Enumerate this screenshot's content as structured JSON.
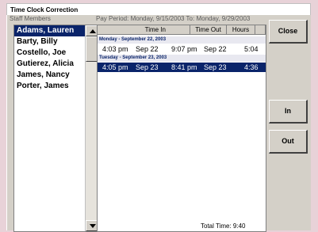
{
  "window": {
    "title": "Time Clock Correction"
  },
  "staff": {
    "label": "Staff Members",
    "items": [
      "Adams, Lauren",
      "Barty, Billy",
      "Costello, Joe",
      "Gutierez, Alicia",
      "James, Nancy",
      "Porter, James"
    ],
    "selected_index": 0
  },
  "pay_period": {
    "text": "Pay Period: Monday, 9/15/2003  To: Monday, 9/29/2003"
  },
  "grid": {
    "columns": [
      "Time In",
      "Time Out",
      "Hours"
    ],
    "days": [
      {
        "header": "Monday - September 22, 2003",
        "entries": [
          {
            "time_in": "4:03 pm",
            "date_in": "Sep 22",
            "time_out": "9:07 pm",
            "date_out": "Sep 22",
            "hours": "5:04"
          }
        ]
      },
      {
        "header": "Tuesday - September 23, 2003",
        "entries": [
          {
            "time_in": "4:05 pm",
            "date_in": "Sep 23",
            "time_out": "8:41 pm",
            "date_out": "Sep 23",
            "hours": "4:36"
          }
        ]
      }
    ],
    "total": "Total Time: 9:40"
  },
  "buttons": {
    "close": "Close",
    "in": "In",
    "out": "Out"
  },
  "colors": {
    "selection": "#0a246a",
    "panel": "#d4d0c8",
    "background": "#e8d2d8"
  }
}
